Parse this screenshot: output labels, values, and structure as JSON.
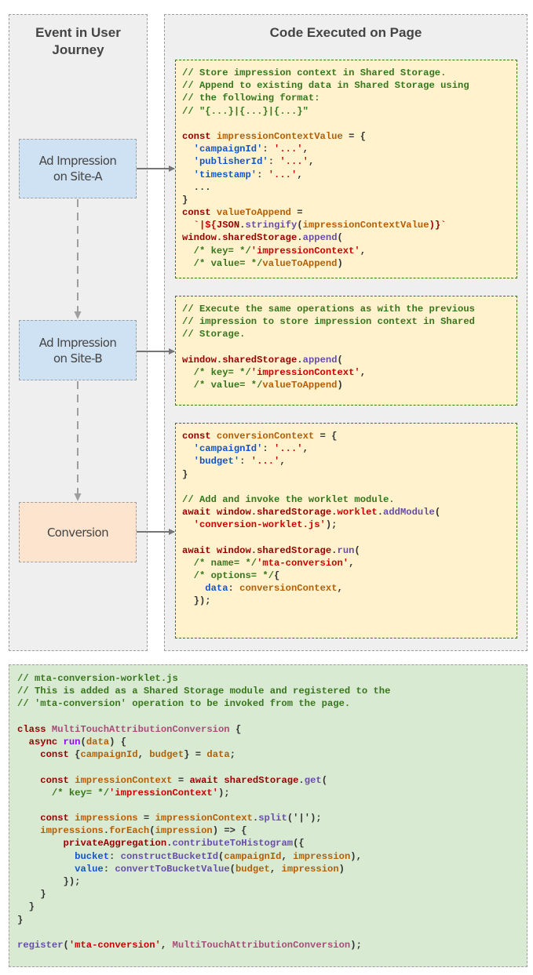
{
  "left_panel": {
    "title_line1": "Event in User",
    "title_line2": "Journey"
  },
  "right_panel": {
    "title": "Code Executed on Page"
  },
  "events": [
    {
      "line1": "Ad Impression",
      "line2": "on Site-A",
      "color": "#cfe2f3"
    },
    {
      "line1": "Ad Impression",
      "line2": "on Site-B",
      "color": "#cfe2f3"
    },
    {
      "line1": "Conversion",
      "line2": "",
      "color": "#fde4cf"
    }
  ],
  "colors": {
    "comment": "#38761d",
    "keyword": "#990000",
    "variable": "#b45f06",
    "key": "#1155cc",
    "string": "#cc0000",
    "function": "#674ea7",
    "panel_bg": "#efefef",
    "code_bg": "#fff2cc",
    "worklet_bg": "#d9ead3"
  },
  "code_blocks": [
    {
      "lines": [
        [
          [
            "c",
            "// Store impression context in Shared Storage."
          ]
        ],
        [
          [
            "c",
            "// Append to existing data in Shared Storage using"
          ]
        ],
        [
          [
            "c",
            "// the following format:"
          ]
        ],
        [
          [
            "c",
            "// \"{...}|{...}|{...}\""
          ]
        ],
        [],
        [
          [
            "k",
            "const "
          ],
          [
            "v",
            "impressionContextValue"
          ],
          [
            "p",
            " = {"
          ]
        ],
        [
          [
            "p",
            "  "
          ],
          [
            "y",
            "'campaignId'"
          ],
          [
            "p",
            ": "
          ],
          [
            "s",
            "'...'"
          ],
          [
            "p",
            ","
          ]
        ],
        [
          [
            "p",
            "  "
          ],
          [
            "y",
            "'publisherId'"
          ],
          [
            "p",
            ": "
          ],
          [
            "s",
            "'...'"
          ],
          [
            "p",
            ","
          ]
        ],
        [
          [
            "p",
            "  "
          ],
          [
            "y",
            "'timestamp'"
          ],
          [
            "p",
            ": "
          ],
          [
            "s",
            "'...'"
          ],
          [
            "p",
            ","
          ]
        ],
        [
          [
            "p",
            "  ..."
          ]
        ],
        [
          [
            "p",
            "}"
          ]
        ],
        [
          [
            "k",
            "const "
          ],
          [
            "v",
            "valueToAppend"
          ],
          [
            "p",
            " ="
          ]
        ],
        [
          [
            "p",
            "  "
          ],
          [
            "s",
            "`|${"
          ],
          [
            "k",
            "JSON"
          ],
          [
            "p",
            "."
          ],
          [
            "f",
            "stringify"
          ],
          [
            "p",
            "("
          ],
          [
            "v",
            "impressionContextValue"
          ],
          [
            "k",
            ")}"
          ],
          [
            "s",
            "`"
          ]
        ],
        [
          [
            "k",
            "window"
          ],
          [
            "p",
            "."
          ],
          [
            "k",
            "sharedStorage"
          ],
          [
            "p",
            "."
          ],
          [
            "f",
            "append"
          ],
          [
            "p",
            "("
          ]
        ],
        [
          [
            "p",
            "  "
          ],
          [
            "c",
            "/* key= */"
          ],
          [
            "s",
            "'impressionContext'"
          ],
          [
            "p",
            ","
          ]
        ],
        [
          [
            "p",
            "  "
          ],
          [
            "c",
            "/* value= */"
          ],
          [
            "v",
            "valueToAppend"
          ],
          [
            "p",
            ")"
          ]
        ]
      ]
    },
    {
      "lines": [
        [
          [
            "c",
            "// Execute the same operations as with the previous"
          ]
        ],
        [
          [
            "c",
            "// impression to store impression context in Shared"
          ]
        ],
        [
          [
            "c",
            "// Storage."
          ]
        ],
        [],
        [
          [
            "k",
            "window"
          ],
          [
            "p",
            "."
          ],
          [
            "k",
            "sharedStorage"
          ],
          [
            "p",
            "."
          ],
          [
            "f",
            "append"
          ],
          [
            "p",
            "("
          ]
        ],
        [
          [
            "p",
            "  "
          ],
          [
            "c",
            "/* key= */"
          ],
          [
            "s",
            "'impressionContext'"
          ],
          [
            "p",
            ","
          ]
        ],
        [
          [
            "p",
            "  "
          ],
          [
            "c",
            "/* value= */"
          ],
          [
            "v",
            "valueToAppend"
          ],
          [
            "p",
            ")"
          ]
        ]
      ]
    },
    {
      "lines": [
        [
          [
            "k",
            "const "
          ],
          [
            "v",
            "conversionContext"
          ],
          [
            "p",
            " = {"
          ]
        ],
        [
          [
            "p",
            "  "
          ],
          [
            "y",
            "'campaignId'"
          ],
          [
            "p",
            ": "
          ],
          [
            "s",
            "'...'"
          ],
          [
            "p",
            ","
          ]
        ],
        [
          [
            "p",
            "  "
          ],
          [
            "y",
            "'budget'"
          ],
          [
            "p",
            ": "
          ],
          [
            "s",
            "'...'"
          ],
          [
            "p",
            ","
          ]
        ],
        [
          [
            "p",
            "}"
          ]
        ],
        [],
        [
          [
            "c",
            "// Add and invoke the worklet module."
          ]
        ],
        [
          [
            "k",
            "await window"
          ],
          [
            "p",
            "."
          ],
          [
            "k",
            "sharedStorage"
          ],
          [
            "p",
            "."
          ],
          [
            "s",
            "worklet"
          ],
          [
            "p",
            "."
          ],
          [
            "f",
            "addModule"
          ],
          [
            "p",
            "("
          ]
        ],
        [
          [
            "p",
            "  "
          ],
          [
            "s",
            "'conversion-worklet.js'"
          ],
          [
            "p",
            ");"
          ]
        ],
        [],
        [
          [
            "k",
            "await window"
          ],
          [
            "p",
            "."
          ],
          [
            "k",
            "sharedStorage"
          ],
          [
            "p",
            "."
          ],
          [
            "f",
            "run"
          ],
          [
            "p",
            "("
          ]
        ],
        [
          [
            "p",
            "  "
          ],
          [
            "c",
            "/* name= */"
          ],
          [
            "s",
            "'mta-conversion'"
          ],
          [
            "p",
            ","
          ]
        ],
        [
          [
            "p",
            "  "
          ],
          [
            "c",
            "/* options= */"
          ],
          [
            "p",
            "{"
          ]
        ],
        [
          [
            "p",
            "    "
          ],
          [
            "y",
            "data"
          ],
          [
            "p",
            ": "
          ],
          [
            "v",
            "conversionContext"
          ],
          [
            "p",
            ","
          ]
        ],
        [
          [
            "p",
            "  });"
          ]
        ]
      ]
    }
  ],
  "worklet": {
    "lines": [
      [
        [
          "c",
          "// mta-conversion-worklet.js"
        ]
      ],
      [
        [
          "c",
          "// This is added as a Shared Storage module and registered to the"
        ]
      ],
      [
        [
          "c",
          "// 'mta-conversion' operation to be invoked from the page."
        ]
      ],
      [],
      [
        [
          "k",
          "class "
        ],
        [
          "m",
          "MultiTouchAttributionConversion"
        ],
        [
          "p",
          " {"
        ]
      ],
      [
        [
          "p",
          "  "
        ],
        [
          "k",
          "async "
        ],
        [
          "g",
          "run"
        ],
        [
          "p",
          "("
        ],
        [
          "v",
          "data"
        ],
        [
          "p",
          ") {"
        ]
      ],
      [
        [
          "p",
          "    "
        ],
        [
          "k",
          "const "
        ],
        [
          "p",
          "{"
        ],
        [
          "v",
          "campaignId"
        ],
        [
          "p",
          ", "
        ],
        [
          "v",
          "budget"
        ],
        [
          "p",
          "} = "
        ],
        [
          "v",
          "data"
        ],
        [
          "p",
          ";"
        ]
      ],
      [],
      [
        [
          "p",
          "    "
        ],
        [
          "k",
          "const "
        ],
        [
          "v",
          "impressionContext"
        ],
        [
          "p",
          " = "
        ],
        [
          "k",
          "await sharedStorage"
        ],
        [
          "p",
          "."
        ],
        [
          "f",
          "get"
        ],
        [
          "p",
          "("
        ]
      ],
      [
        [
          "p",
          "      "
        ],
        [
          "c",
          "/* key= */"
        ],
        [
          "s",
          "'impressionContext'"
        ],
        [
          "p",
          ");"
        ]
      ],
      [],
      [
        [
          "p",
          "    "
        ],
        [
          "k",
          "const "
        ],
        [
          "v",
          "impressions"
        ],
        [
          "p",
          " = "
        ],
        [
          "v",
          "impressionContext"
        ],
        [
          "p",
          "."
        ],
        [
          "f",
          "split"
        ],
        [
          "p",
          "('|');"
        ]
      ],
      [
        [
          "p",
          "    "
        ],
        [
          "v",
          "impressions"
        ],
        [
          "p",
          "."
        ],
        [
          "v",
          "forEach"
        ],
        [
          "p",
          "("
        ],
        [
          "v",
          "impression"
        ],
        [
          "p",
          ") => {"
        ]
      ],
      [
        [
          "p",
          "        "
        ],
        [
          "k",
          "privateAggregation"
        ],
        [
          "p",
          "."
        ],
        [
          "f",
          "contributeToHistogram"
        ],
        [
          "p",
          "({"
        ]
      ],
      [
        [
          "p",
          "          "
        ],
        [
          "y",
          "bucket"
        ],
        [
          "p",
          ": "
        ],
        [
          "f",
          "constructBucketId"
        ],
        [
          "p",
          "("
        ],
        [
          "v",
          "campaignId"
        ],
        [
          "p",
          ", "
        ],
        [
          "v",
          "impression"
        ],
        [
          "p",
          "),"
        ]
      ],
      [
        [
          "p",
          "          "
        ],
        [
          "y",
          "value"
        ],
        [
          "p",
          ": "
        ],
        [
          "f",
          "convertToBucketValue"
        ],
        [
          "p",
          "("
        ],
        [
          "v",
          "budget"
        ],
        [
          "p",
          ", "
        ],
        [
          "v",
          "impression"
        ],
        [
          "p",
          ")"
        ]
      ],
      [
        [
          "p",
          "        });"
        ]
      ],
      [
        [
          "p",
          "    }"
        ]
      ],
      [
        [
          "p",
          "  }"
        ]
      ],
      [
        [
          "p",
          "}"
        ]
      ],
      [],
      [
        [
          "f",
          "register"
        ],
        [
          "p",
          "("
        ],
        [
          "s",
          "'mta-conversion'"
        ],
        [
          "p",
          ", "
        ],
        [
          "m",
          "MultiTouchAttributionConversion"
        ],
        [
          "p",
          ");"
        ]
      ]
    ]
  }
}
